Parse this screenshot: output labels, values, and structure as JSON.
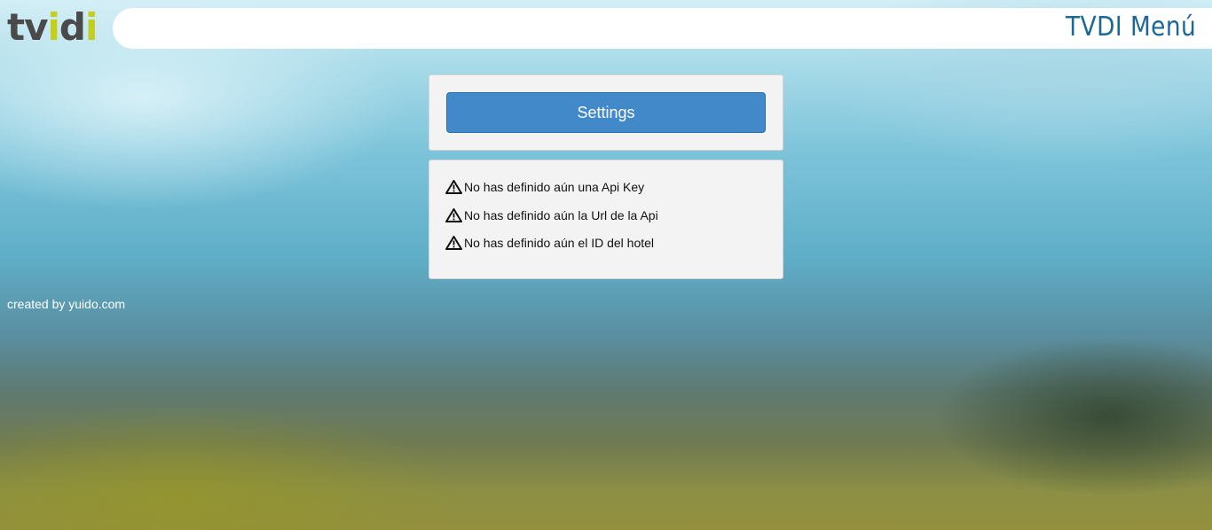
{
  "header": {
    "logo_text": "tvidi",
    "title": "TVDI Menú"
  },
  "settings_panel": {
    "button_label": "Settings"
  },
  "warnings": {
    "icon": "warning-triangle-icon",
    "items": [
      "No has definido aún una Api Key",
      "No has definido aún la Url de la Api",
      "No has definido aún el ID del hotel"
    ]
  },
  "footer": {
    "credit": "created by yuido.com"
  },
  "colors": {
    "accent": "#4289c9",
    "title": "#1b6796",
    "logo_dark": "#4a4a4a",
    "logo_lime": "#c4cf1a"
  }
}
